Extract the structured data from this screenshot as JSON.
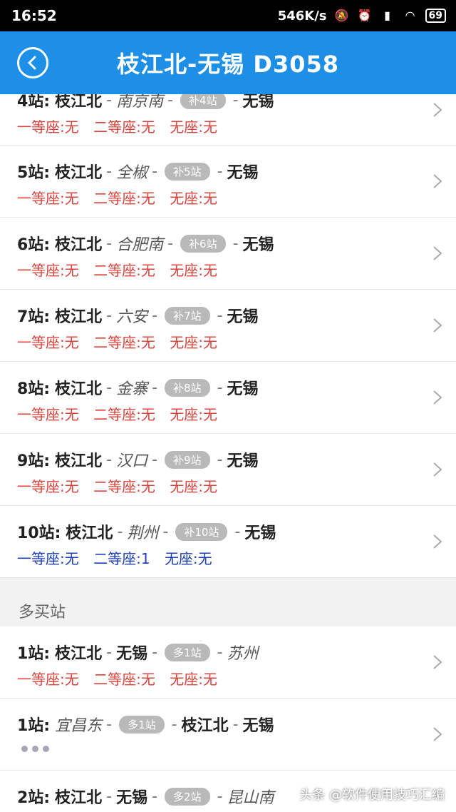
{
  "status_bar": {
    "time": "16:52",
    "speed": "546K/s",
    "battery": "69"
  },
  "header": {
    "title": "枝江北-无锡 D3058"
  },
  "rows_top": [
    {
      "num": "4站:",
      "from": "枝江北",
      "via": "南京南",
      "badge": "补4站",
      "to": "无锡",
      "seats": [
        "一等座:无",
        "二等座:无",
        "无座:无"
      ],
      "seat_color": "red"
    },
    {
      "num": "5站:",
      "from": "枝江北",
      "via": "全椒",
      "badge": "补5站",
      "to": "无锡",
      "seats": [
        "一等座:无",
        "二等座:无",
        "无座:无"
      ],
      "seat_color": "red"
    },
    {
      "num": "6站:",
      "from": "枝江北",
      "via": "合肥南",
      "badge": "补6站",
      "to": "无锡",
      "seats": [
        "一等座:无",
        "二等座:无",
        "无座:无"
      ],
      "seat_color": "red"
    },
    {
      "num": "7站:",
      "from": "枝江北",
      "via": "六安",
      "badge": "补7站",
      "to": "无锡",
      "seats": [
        "一等座:无",
        "二等座:无",
        "无座:无"
      ],
      "seat_color": "red"
    },
    {
      "num": "8站:",
      "from": "枝江北",
      "via": "金寨",
      "badge": "补8站",
      "to": "无锡",
      "seats": [
        "一等座:无",
        "二等座:无",
        "无座:无"
      ],
      "seat_color": "red"
    },
    {
      "num": "9站:",
      "from": "枝江北",
      "via": "汉口",
      "badge": "补9站",
      "to": "无锡",
      "seats": [
        "一等座:无",
        "二等座:无",
        "无座:无"
      ],
      "seat_color": "red"
    },
    {
      "num": "10站:",
      "from": "枝江北",
      "via": "荆州",
      "badge": "补10站",
      "to": "无锡",
      "seats": [
        "一等座:无",
        "二等座:1",
        "无座:无"
      ],
      "seat_color": "blue"
    }
  ],
  "section": {
    "title": "多买站"
  },
  "rows_more": [
    {
      "num": "1站:",
      "a": "枝江北",
      "b": "无锡",
      "badge": "多1站",
      "c": "苏州",
      "seats": [
        "一等座:无",
        "二等座:无",
        "无座:无"
      ]
    },
    {
      "num": "1站:",
      "a": "宜昌东",
      "badge": "多1站",
      "b": "枝江北",
      "c": "无锡"
    },
    {
      "num": "2站:",
      "a": "枝江北",
      "b": "无锡",
      "badge": "多2站",
      "c": "昆山南"
    }
  ],
  "watermark": "头条 @软件使用技巧汇编",
  "colors": {
    "primary": "#1e8fe6",
    "seat_red": "#d9443d",
    "seat_blue": "#1d3fb8"
  }
}
